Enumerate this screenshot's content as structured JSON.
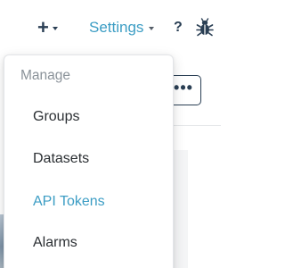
{
  "navbar": {
    "plus_label": "+",
    "settings_label": "Settings",
    "help_label": "?"
  },
  "dropdown": {
    "header": "Manage",
    "items": [
      {
        "label": "Groups",
        "active": false
      },
      {
        "label": "Datasets",
        "active": false
      },
      {
        "label": "API Tokens",
        "active": true
      },
      {
        "label": "Alarms",
        "active": false
      }
    ]
  },
  "toolbar": {
    "more_label": "•••"
  },
  "icons": {
    "add": "plus-icon",
    "settings_caret": "chevron-down-icon",
    "help": "help-icon",
    "bug": "bug-icon",
    "more": "more-horizontal-icon"
  },
  "colors": {
    "brand_dark": "#2a3f54",
    "accent": "#3c9dc4",
    "muted": "#8a9299",
    "text": "#2b2f33"
  }
}
